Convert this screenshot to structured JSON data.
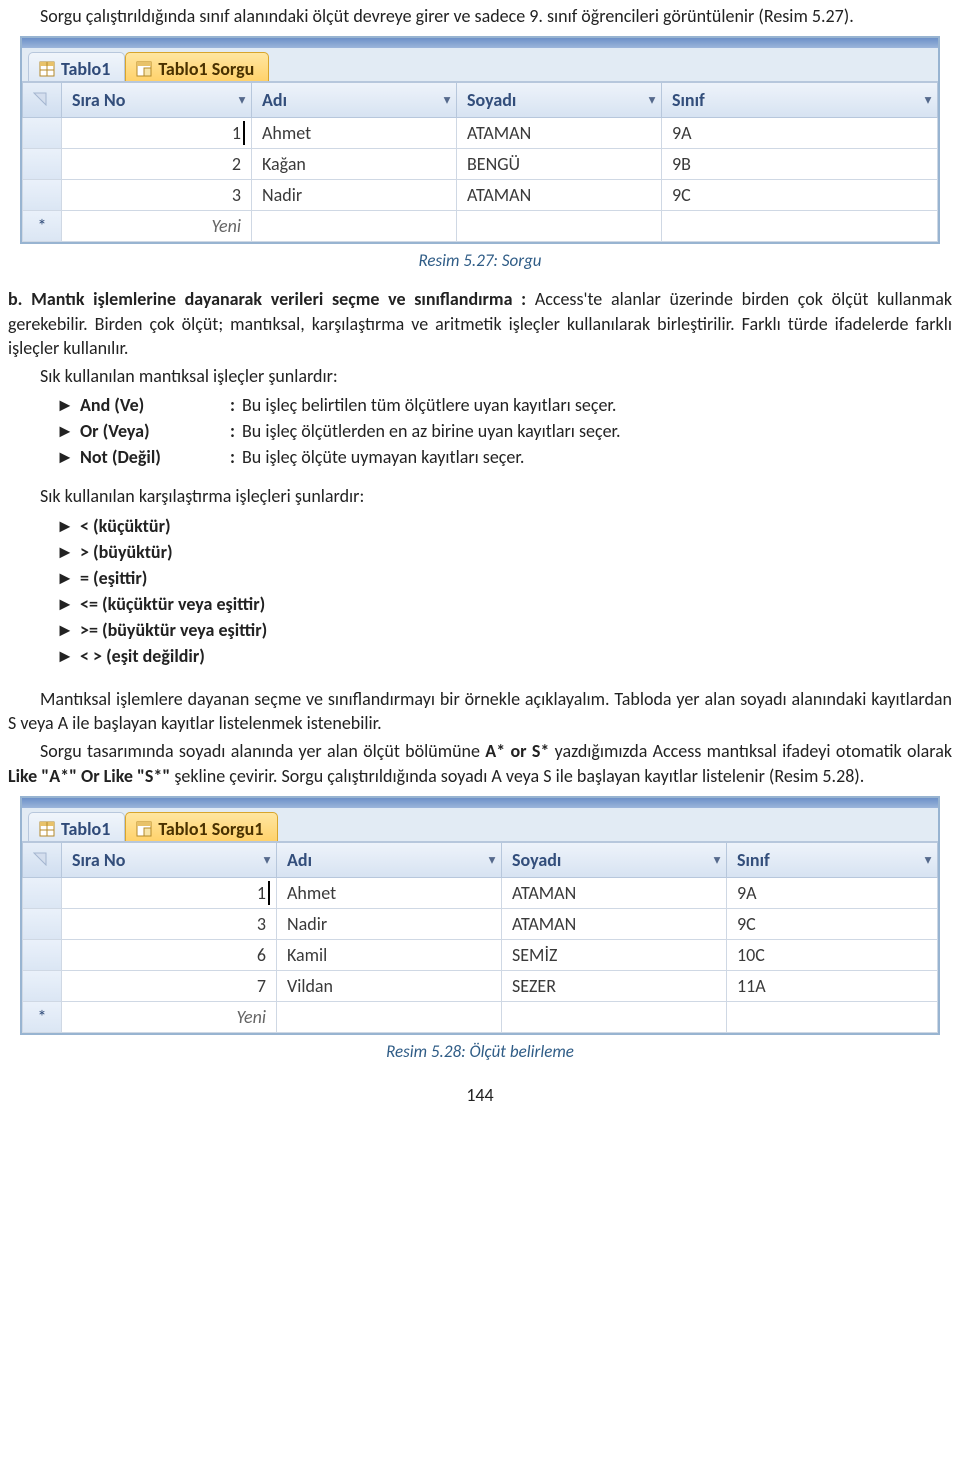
{
  "para1": "Sorgu çalıştırıldığında sınıf alanındaki ölçüt devreye girer ve sadece 9. sınıf öğrencileri görüntülenir (Resim 5.27).",
  "figure1": {
    "tab1": "Tablo1",
    "tab2": "Tablo1 Sorgu",
    "col_sel": "",
    "col1": "Sıra No",
    "col2": "Adı",
    "col3": "Soyadı",
    "col4": "Sınıf",
    "rows": [
      {
        "no": "1",
        "adi": "Ahmet",
        "soy": "ATAMAN",
        "snf": "9A"
      },
      {
        "no": "2",
        "adi": "Kağan",
        "soy": "BENGÜ",
        "snf": "9B"
      },
      {
        "no": "3",
        "adi": "Nadir",
        "soy": "ATAMAN",
        "snf": "9C"
      }
    ],
    "new_row_label": "Yeni",
    "star": "*"
  },
  "caption1": "Resim 5.27: Sorgu",
  "section_b_lead": "b. Mantık işlemlerine dayanarak verileri seçme ve sınıflandırma : ",
  "section_b_body": "Access'te alanlar üzerinde birden çok ölçüt kullanmak gerekebilir. Birden çok ölçüt; mantıksal, karşılaştırma ve aritmetik işleçler kullanılarak birleştirilir. Farklı türde ifadelerde farklı işleçler kullanılır.",
  "ops_intro": "Sık kullanılan mantıksal işleçler şunlardır:",
  "ops": {
    "arrow": "►",
    "colon": ":",
    "items": [
      {
        "name": "And (Ve)",
        "desc": "Bu işleç belirtilen tüm ölçütlere uyan kayıtları seçer."
      },
      {
        "name": "Or (Veya)",
        "desc": "Bu işleç ölçütlerden en az birine uyan kayıtları seçer."
      },
      {
        "name": "Not (Değil)",
        "desc": "Bu işleç ölçüte uymayan kayıtları seçer."
      }
    ]
  },
  "cmp_intro": "Sık kullanılan karşılaştırma işleçleri şunlardır:",
  "cmp": {
    "arrow": "►",
    "items": [
      "<  (küçüktür)",
      "> (büyüktür)",
      "= (eşittir)",
      "<= (küçüktür veya eşittir)",
      ">= (büyüktür veya eşittir)",
      "< > (eşit değildir)"
    ]
  },
  "para2a": "Mantıksal işlemlere dayanan seçme ve sınıflandırmayı bir örnekle açıklayalım. Tabloda yer alan soyadı alanındaki kayıtlardan S veya A ile başlayan kayıtlar listelenmek istenebilir.",
  "para2b_pre": "Sorgu tasarımında soyadı alanında yer alan ölçüt bölümüne ",
  "para2b_b1": "A* or S*",
  "para2b_mid": " yazdığımızda Access mantıksal ifadeyi otomatik olarak ",
  "para2b_b2": "Like \"A*\" Or Like \"S*\"",
  "para2b_post": " şekline çevirir. Sorgu çalıştırıldığında soyadı A veya S ile başlayan kayıtlar listelenir (Resim 5.28).",
  "figure2": {
    "tab1": "Tablo1",
    "tab2": "Tablo1 Sorgu1",
    "col1": "Sıra No",
    "col2": "Adı",
    "col3": "Soyadı",
    "col4": "Sınıf",
    "rows": [
      {
        "no": "1",
        "adi": "Ahmet",
        "soy": "ATAMAN",
        "snf": "9A"
      },
      {
        "no": "3",
        "adi": "Nadir",
        "soy": "ATAMAN",
        "snf": "9C"
      },
      {
        "no": "6",
        "adi": "Kamil",
        "soy": "SEMİZ",
        "snf": "10C"
      },
      {
        "no": "7",
        "adi": "Vildan",
        "soy": "SEZER",
        "snf": "11A"
      }
    ],
    "new_row_label": "Yeni",
    "star": "*"
  },
  "caption2": "Resim 5.28: Ölçüt belirleme",
  "page": "144",
  "icons": {
    "dropdown": "▾"
  }
}
